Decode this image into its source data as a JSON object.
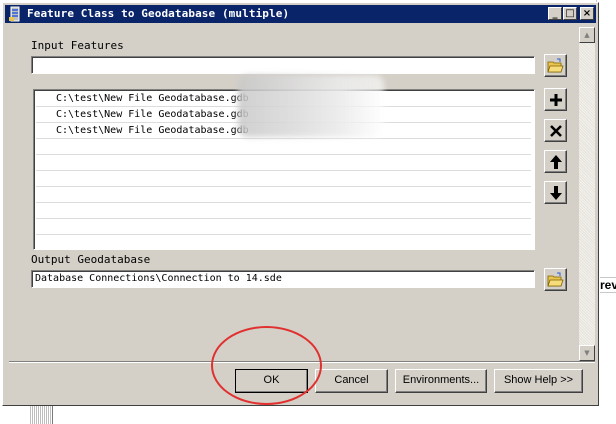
{
  "window": {
    "title": "Feature Class to Geodatabase (multiple)",
    "title_buttons": {
      "minimize": "_",
      "maximize": "□",
      "close": "×"
    }
  },
  "form": {
    "input_features_label": "Input Features",
    "input_features_value": "",
    "list_rows": [
      "C:\\test\\New File Geodatabase.gdb",
      "C:\\test\\New File Geodatabase.gdb",
      "C:\\test\\New File Geodatabase.gdb",
      "",
      "",
      "",
      "",
      "",
      "",
      ""
    ],
    "output_label": "Output Geodatabase",
    "output_value": "Database Connections\\Connection to 14.sde"
  },
  "buttons": {
    "ok": "OK",
    "cancel": "Cancel",
    "environments": "Environments...",
    "show_help": "Show Help >>"
  },
  "background": {
    "right_edge_text": "rev"
  },
  "colors": {
    "titlebar": "#0a246a",
    "dialog_face": "#d4d0c8",
    "annotation": "#e0302f"
  },
  "icons": {
    "browse": "folder-open-icon",
    "add": "plus-icon",
    "remove": "x-icon",
    "move_up": "arrow-up-icon",
    "move_down": "arrow-down-icon"
  }
}
